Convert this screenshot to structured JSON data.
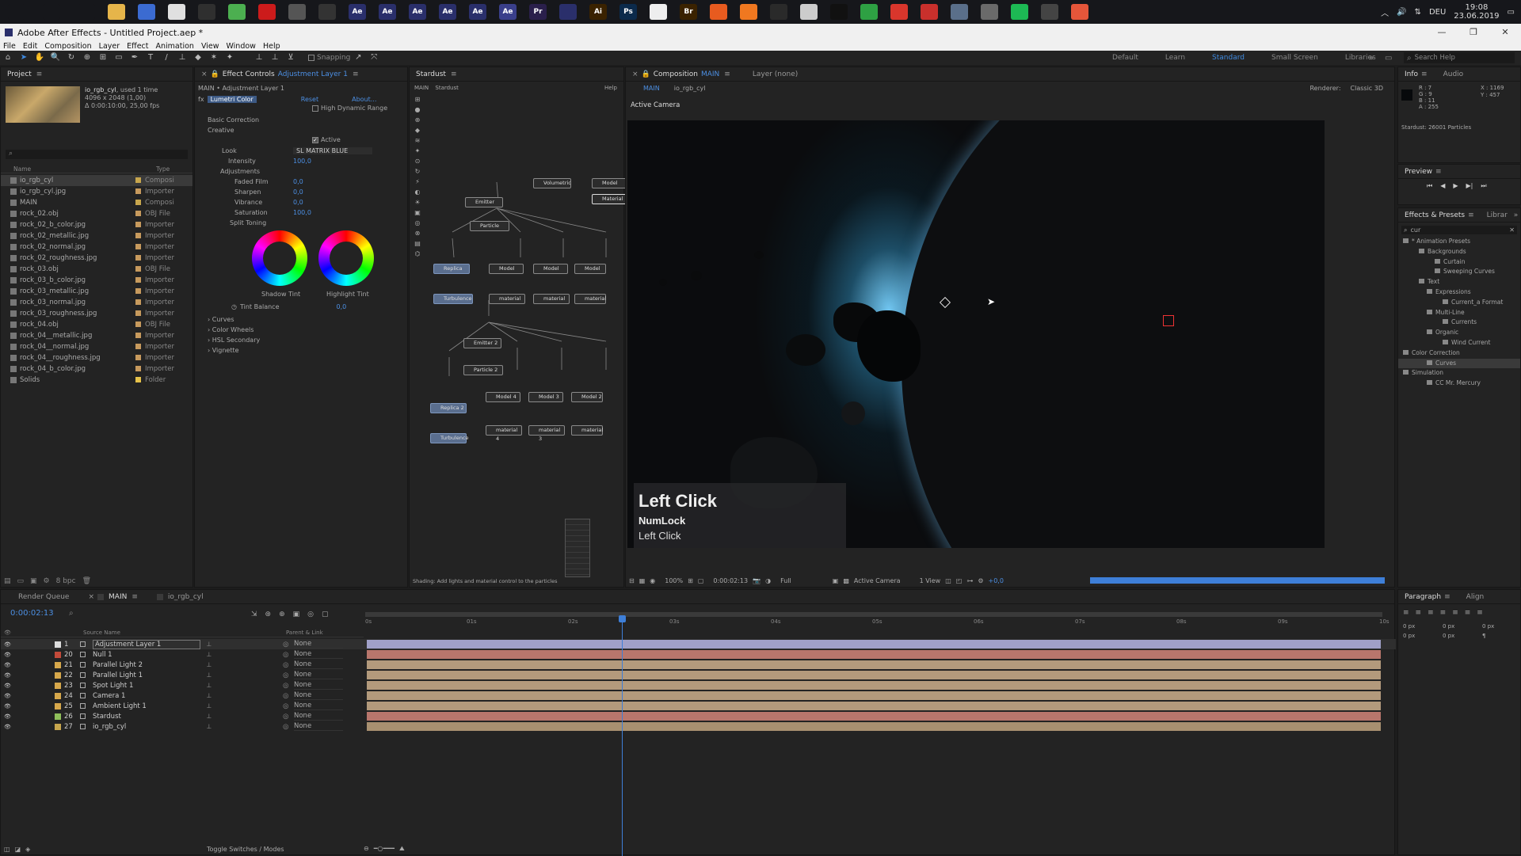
{
  "taskbar": {
    "time": "19:08",
    "date": "23.06.2019",
    "lang": "DEU",
    "icons": [
      {
        "label": "",
        "bg": "#16171b",
        "name": "windows-start-icon"
      },
      {
        "label": "",
        "bg": "#16171b",
        "name": "search-circle-icon"
      },
      {
        "label": "",
        "bg": "#16171b",
        "name": "task-view-icon"
      },
      {
        "label": "",
        "bg": "#e6b54a",
        "name": "folder-icon"
      },
      {
        "label": "",
        "bg": "#3b6bd1",
        "name": "app-icon-1"
      },
      {
        "label": "",
        "bg": "#e0e0e0",
        "name": "app-icon-2"
      },
      {
        "label": "",
        "bg": "#2f2f2f",
        "name": "store-icon"
      },
      {
        "label": "",
        "bg": "#4caf50",
        "name": "chrome-icon"
      },
      {
        "label": "",
        "bg": "#cc1b1b",
        "name": "opera-icon"
      },
      {
        "label": "",
        "bg": "#555",
        "name": "app-icon-3"
      },
      {
        "label": "",
        "bg": "#333",
        "name": "app-icon-4"
      },
      {
        "label": "Ae",
        "bg": "#2a2f6b",
        "name": "after-effects-icon-1"
      },
      {
        "label": "Ae",
        "bg": "#2a2f6b",
        "name": "after-effects-icon-2"
      },
      {
        "label": "Ae",
        "bg": "#2a2f6b",
        "name": "after-effects-icon-3"
      },
      {
        "label": "Ae",
        "bg": "#2a2f6b",
        "name": "after-effects-icon-4"
      },
      {
        "label": "Ae",
        "bg": "#2a2f6b",
        "name": "after-effects-icon-5"
      },
      {
        "label": "Ae",
        "bg": "#3a3f8b",
        "name": "after-effects-icon-6"
      },
      {
        "label": "Pr",
        "bg": "#2a1f4b",
        "name": "premiere-icon"
      },
      {
        "label": "",
        "bg": "#2a2f6b",
        "name": "app-icon-5"
      },
      {
        "label": "Ai",
        "bg": "#3a2200",
        "name": "illustrator-icon"
      },
      {
        "label": "Ps",
        "bg": "#0b2a4b",
        "name": "photoshop-icon"
      },
      {
        "label": "",
        "bg": "#eee",
        "name": "document-icon"
      },
      {
        "label": "Br",
        "bg": "#3a2200",
        "name": "bridge-icon"
      },
      {
        "label": "",
        "bg": "#e85b1f",
        "name": "app-icon-6"
      },
      {
        "label": "",
        "bg": "#f07820",
        "name": "app-icon-7"
      },
      {
        "label": "",
        "bg": "#2a2a2a",
        "name": "app-icon-8"
      },
      {
        "label": "",
        "bg": "#ccc",
        "name": "app-icon-9"
      },
      {
        "label": "",
        "bg": "#111",
        "name": "app-icon-10"
      },
      {
        "label": "",
        "bg": "#2ea043",
        "name": "app-icon-11"
      },
      {
        "label": "",
        "bg": "#d9362c",
        "name": "app-icon-12"
      },
      {
        "label": "",
        "bg": "#c9302c",
        "name": "filezilla-icon"
      },
      {
        "label": "",
        "bg": "#5a6f8a",
        "name": "app-icon-13"
      },
      {
        "label": "",
        "bg": "#6a6a6a",
        "name": "app-icon-14"
      },
      {
        "label": "",
        "bg": "#1db954",
        "name": "spotify-icon"
      },
      {
        "label": "",
        "bg": "#444",
        "name": "app-icon-15"
      },
      {
        "label": "",
        "bg": "#e5563a",
        "name": "app-icon-16"
      }
    ]
  },
  "window": {
    "title": "Adobe After Effects - Untitled Project.aep *"
  },
  "menu": [
    "File",
    "Edit",
    "Composition",
    "Layer",
    "Effect",
    "Animation",
    "View",
    "Window",
    "Help"
  ],
  "toolbar": {
    "snapping": "Snapping",
    "workspaces": [
      "Default",
      "Learn",
      "Standard",
      "Small Screen",
      "Libraries"
    ],
    "search": "Search Help"
  },
  "project": {
    "tab": "Project",
    "thumb_name": "io_rgb_cyl",
    "thumb_used": ", used 1 time",
    "thumb_info1": "4096 x 2048 (1,00)",
    "thumb_info2": "Δ 0:00:10:00, 25,00 fps",
    "col_name": "Name",
    "col_type": "Type",
    "footer": "8 bpc",
    "items": [
      {
        "name": "io_rgb_cyl",
        "type": "Composi",
        "color": "#c7a64d"
      },
      {
        "name": "io_rgb_cyl.jpg",
        "type": "Importer",
        "color": "#c79a5d"
      },
      {
        "name": "MAIN",
        "type": "Composi",
        "color": "#c7a64d"
      },
      {
        "name": "rock_02.obj",
        "type": "OBJ File",
        "color": "#c79a5d"
      },
      {
        "name": "rock_02_b_color.jpg",
        "type": "Importer",
        "color": "#c79a5d"
      },
      {
        "name": "rock_02_metallic.jpg",
        "type": "Importer",
        "color": "#c79a5d"
      },
      {
        "name": "rock_02_normal.jpg",
        "type": "Importer",
        "color": "#c79a5d"
      },
      {
        "name": "rock_02_roughness.jpg",
        "type": "Importer",
        "color": "#c79a5d"
      },
      {
        "name": "rock_03.obj",
        "type": "OBJ File",
        "color": "#c79a5d"
      },
      {
        "name": "rock_03_b_color.jpg",
        "type": "Importer",
        "color": "#c79a5d"
      },
      {
        "name": "rock_03_metallic.jpg",
        "type": "Importer",
        "color": "#c79a5d"
      },
      {
        "name": "rock_03_normal.jpg",
        "type": "Importer",
        "color": "#c79a5d"
      },
      {
        "name": "rock_03_roughness.jpg",
        "type": "Importer",
        "color": "#c79a5d"
      },
      {
        "name": "rock_04.obj",
        "type": "OBJ File",
        "color": "#c79a5d"
      },
      {
        "name": "rock_04__metallic.jpg",
        "type": "Importer",
        "color": "#c79a5d"
      },
      {
        "name": "rock_04__normal.jpg",
        "type": "Importer",
        "color": "#c79a5d"
      },
      {
        "name": "rock_04__roughness.jpg",
        "type": "Importer",
        "color": "#c79a5d"
      },
      {
        "name": "rock_04_b_color.jpg",
        "type": "Importer",
        "color": "#c79a5d"
      },
      {
        "name": "Solids",
        "type": "Folder",
        "color": "#e6c24a"
      }
    ]
  },
  "effect_controls": {
    "tab": "Effect Controls",
    "layer": "Adjustment Layer 1",
    "path": "MAIN • Adjustment Layer 1",
    "effect": "Lumetri Color",
    "reset": "Reset",
    "about": "About...",
    "hdr": "High Dynamic Range",
    "rows": [
      {
        "label": "Basic Correction",
        "value": "",
        "indent": 12
      },
      {
        "label": "Creative",
        "value": "",
        "indent": 12
      },
      {
        "label": "",
        "value": "",
        "indent": 0
      },
      {
        "label": "Look",
        "value": "SL MATRIX BLUE",
        "indent": 30
      },
      {
        "label": "Intensity",
        "value": "100,0",
        "indent": 38
      },
      {
        "label": "Adjustments",
        "value": "",
        "indent": 28
      },
      {
        "label": "Faded Film",
        "value": "0,0",
        "indent": 46
      },
      {
        "label": "Sharpen",
        "value": "0,0",
        "indent": 46
      },
      {
        "label": "Vibrance",
        "value": "0,0",
        "indent": 46
      },
      {
        "label": "Saturation",
        "value": "100,0",
        "indent": 46
      },
      {
        "label": "Split Toning",
        "value": "",
        "indent": 40
      }
    ],
    "active": "Active",
    "shadow_tint": "Shadow Tint",
    "highlight_tint": "Highlight Tint",
    "tint_balance": "Tint Balance",
    "tint_balance_val": "0,0",
    "sections": [
      "Curves",
      "Color Wheels",
      "HSL Secondary",
      "Vignette"
    ]
  },
  "stardust": {
    "tab": "Stardust",
    "crumb_main": "MAIN",
    "crumb_sd": "Stardust",
    "help": "Help",
    "status": "Shading: Add lights and material control to the particles",
    "nodes": [
      {
        "label": "Volumetric",
        "cls": ""
      },
      {
        "label": "Model",
        "cls": ""
      },
      {
        "label": "Material",
        "cls": "white"
      },
      {
        "label": "Emitter",
        "cls": ""
      },
      {
        "label": "Particle",
        "cls": ""
      },
      {
        "label": "Replica",
        "cls": "blue"
      },
      {
        "label": "Model",
        "cls": ""
      },
      {
        "label": "Model",
        "cls": ""
      },
      {
        "label": "Model",
        "cls": ""
      },
      {
        "label": "Turbulence",
        "cls": "blue"
      },
      {
        "label": "material",
        "cls": ""
      },
      {
        "label": "material",
        "cls": ""
      },
      {
        "label": "material",
        "cls": ""
      },
      {
        "label": "Emitter 2",
        "cls": ""
      },
      {
        "label": "Particle 2",
        "cls": ""
      },
      {
        "label": "Replica 2",
        "cls": "blue"
      },
      {
        "label": "Model 4",
        "cls": ""
      },
      {
        "label": "Model 3",
        "cls": ""
      },
      {
        "label": "Model 2",
        "cls": ""
      },
      {
        "label": "Turbulence",
        "cls": "blue"
      },
      {
        "label": "material 4",
        "cls": ""
      },
      {
        "label": "material 3",
        "cls": ""
      },
      {
        "label": "material",
        "cls": ""
      }
    ]
  },
  "composition": {
    "tab_prefix": "Composition",
    "tab_name": "MAIN",
    "layer_tab": "Layer (none)",
    "crumb1": "MAIN",
    "crumb2": "io_rgb_cyl",
    "renderer_label": "Renderer:",
    "renderer": "Classic 3D",
    "camera_label": "Active Camera",
    "footer": {
      "zoom": "100%",
      "time": "0:00:02:13",
      "res": "Full",
      "camera": "Active Camera",
      "views": "1 View",
      "exposure": "+0,0"
    }
  },
  "overlay": {
    "title": "Left Click",
    "line1": "NumLock",
    "line2": "Left Click"
  },
  "info": {
    "tab": "Info",
    "tab2": "Audio",
    "r": "R : 7",
    "g": "G : 9",
    "b": "B : 11",
    "a": "A : 255",
    "x": "X : 1169",
    "y": "Y : 457",
    "stardust": "Stardust: 26001 Particles"
  },
  "preview": {
    "tab": "Preview"
  },
  "effects_presets": {
    "tab": "Effects & Presets",
    "tab2": "Librar",
    "search": "cur",
    "items": [
      {
        "label": "* Animation Presets",
        "indent": 6
      },
      {
        "label": "Backgrounds",
        "indent": 26
      },
      {
        "label": "Curtain",
        "indent": 46
      },
      {
        "label": "Sweeping Curves",
        "indent": 46
      },
      {
        "label": "Text",
        "indent": 26
      },
      {
        "label": "Expressions",
        "indent": 36
      },
      {
        "label": "Current_a Format",
        "indent": 56
      },
      {
        "label": "Multi-Line",
        "indent": 36
      },
      {
        "label": "Currents",
        "indent": 56
      },
      {
        "label": "Organic",
        "indent": 36
      },
      {
        "label": "Wind Current",
        "indent": 56
      },
      {
        "label": "Color Correction",
        "indent": 6
      },
      {
        "label": "Curves",
        "indent": 36
      },
      {
        "label": "Simulation",
        "indent": 6
      },
      {
        "label": "CC Mr. Mercury",
        "indent": 36
      }
    ]
  },
  "timeline": {
    "render_queue": "Render Queue",
    "tab_main": "MAIN",
    "tab2": "io_rgb_cyl",
    "time": "0:00:02:13",
    "source_name": "Source Name",
    "parent_link": "Parent & Link",
    "toggle": "Toggle Switches / Modes",
    "ticks": [
      "0s",
      "01s",
      "02s",
      "03s",
      "04s",
      "05s",
      "06s",
      "07s",
      "08s",
      "09s",
      "10s"
    ],
    "layers": [
      {
        "num": "1",
        "name": "Adjustment Layer 1",
        "parent": "None",
        "color": "#a0a0c8",
        "swatch": "#ddd"
      },
      {
        "num": "20",
        "name": "Null 1",
        "parent": "None",
        "color": "#b8766c",
        "swatch": "#c34a3a"
      },
      {
        "num": "21",
        "name": "Parallel Light 2",
        "parent": "None",
        "color": "#b39a7c",
        "swatch": "#d7a84b"
      },
      {
        "num": "22",
        "name": "Parallel Light 1",
        "parent": "None",
        "color": "#b39a7c",
        "swatch": "#d7a84b"
      },
      {
        "num": "23",
        "name": "Spot Light 1",
        "parent": "None",
        "color": "#b39a7c",
        "swatch": "#d7a84b"
      },
      {
        "num": "24",
        "name": "Camera 1",
        "parent": "None",
        "color": "#b39a7c",
        "swatch": "#d7a84b"
      },
      {
        "num": "25",
        "name": "Ambient Light 1",
        "parent": "None",
        "color": "#b39a7c",
        "swatch": "#d7a84b"
      },
      {
        "num": "26",
        "name": "Stardust",
        "parent": "None",
        "color": "#b8766c",
        "swatch": "#8fbf5a"
      },
      {
        "num": "27",
        "name": "io_rgb_cyl",
        "parent": "None",
        "color": "#a89070",
        "swatch": "#c7a64d"
      }
    ]
  },
  "paragraph": {
    "tab": "Paragraph",
    "tab2": "Align",
    "px": "0 px"
  }
}
